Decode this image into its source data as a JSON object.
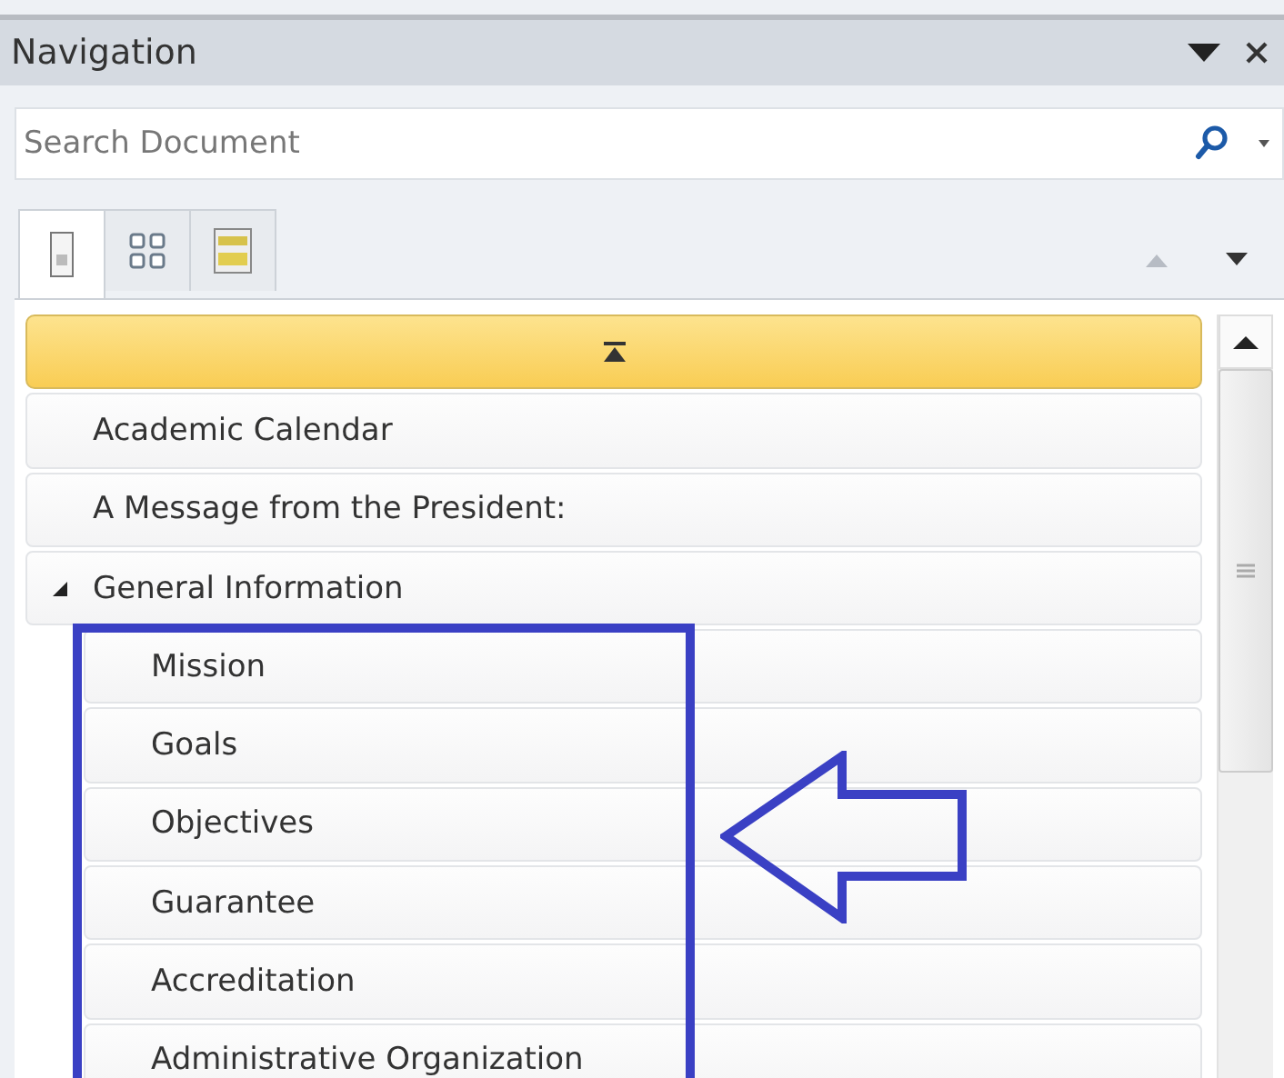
{
  "pane": {
    "title": "Navigation"
  },
  "search": {
    "placeholder": "Search Document"
  },
  "tabs": [
    {
      "kind": "headings",
      "selected": true
    },
    {
      "kind": "pages",
      "selected": false
    },
    {
      "kind": "results",
      "selected": false
    }
  ],
  "top_bar": {
    "selected": true
  },
  "headings": [
    {
      "label": "Academic Calendar",
      "selected": false
    },
    {
      "label": "A Message from the President:",
      "selected": false
    },
    {
      "label": "General Information",
      "selected": false,
      "expanded": true,
      "children": [
        {
          "label": "Mission",
          "selected": false
        },
        {
          "label": "Goals",
          "selected": false
        },
        {
          "label": "Objectives",
          "selected": false
        },
        {
          "label": "Guarantee",
          "selected": false
        },
        {
          "label": "Accreditation",
          "selected": false
        },
        {
          "label": "Administrative Organization",
          "selected": false
        }
      ]
    }
  ]
}
